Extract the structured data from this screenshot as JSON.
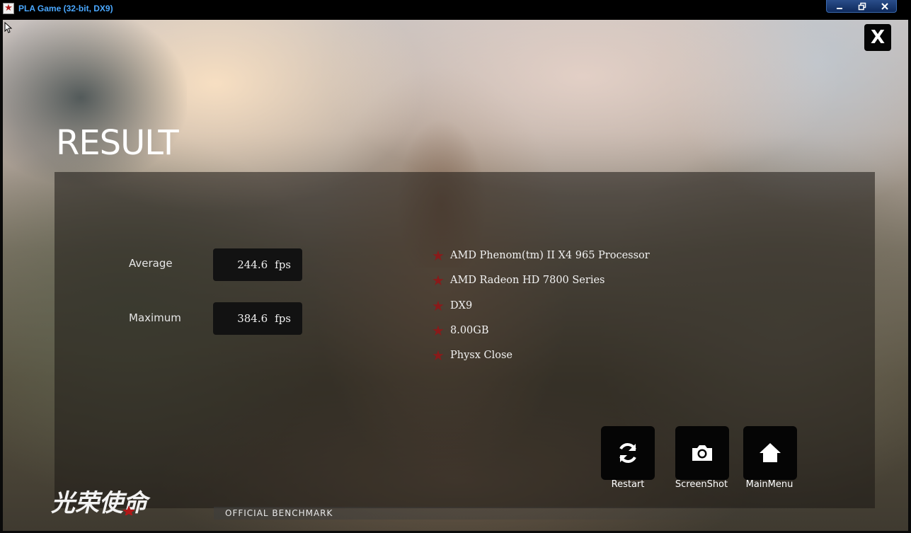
{
  "window": {
    "title": "PLA Game (32-bit, DX9)",
    "app_icon": "red-star-icon",
    "controls": {
      "minimize": "minimize-icon",
      "restore": "restore-icon",
      "close": "close-icon"
    }
  },
  "game": {
    "close_button": "X",
    "heading": "RESULT",
    "stats": [
      {
        "label": "Average",
        "value": "244.6",
        "unit": "fps"
      },
      {
        "label": "Maximum",
        "value": "384.6",
        "unit": "fps"
      }
    ],
    "specs": [
      "AMD Phenom(tm) II X4 965 Processor",
      "AMD Radeon HD 7800 Series",
      "DX9",
      "8.00GB",
      "Physx Close"
    ],
    "actions": [
      {
        "label": "Restart",
        "icon": "refresh-icon"
      },
      {
        "label": "ScreenShot",
        "icon": "camera-icon"
      },
      {
        "label": "MainMenu",
        "icon": "home-icon"
      }
    ],
    "logo_text": "光荣使命",
    "benchmark_label": "OFFICIAL BENCHMARK"
  },
  "colors": {
    "title_text": "#4aa8ff",
    "star_accent": "#8a1a1a",
    "button_bg": "#050505"
  }
}
